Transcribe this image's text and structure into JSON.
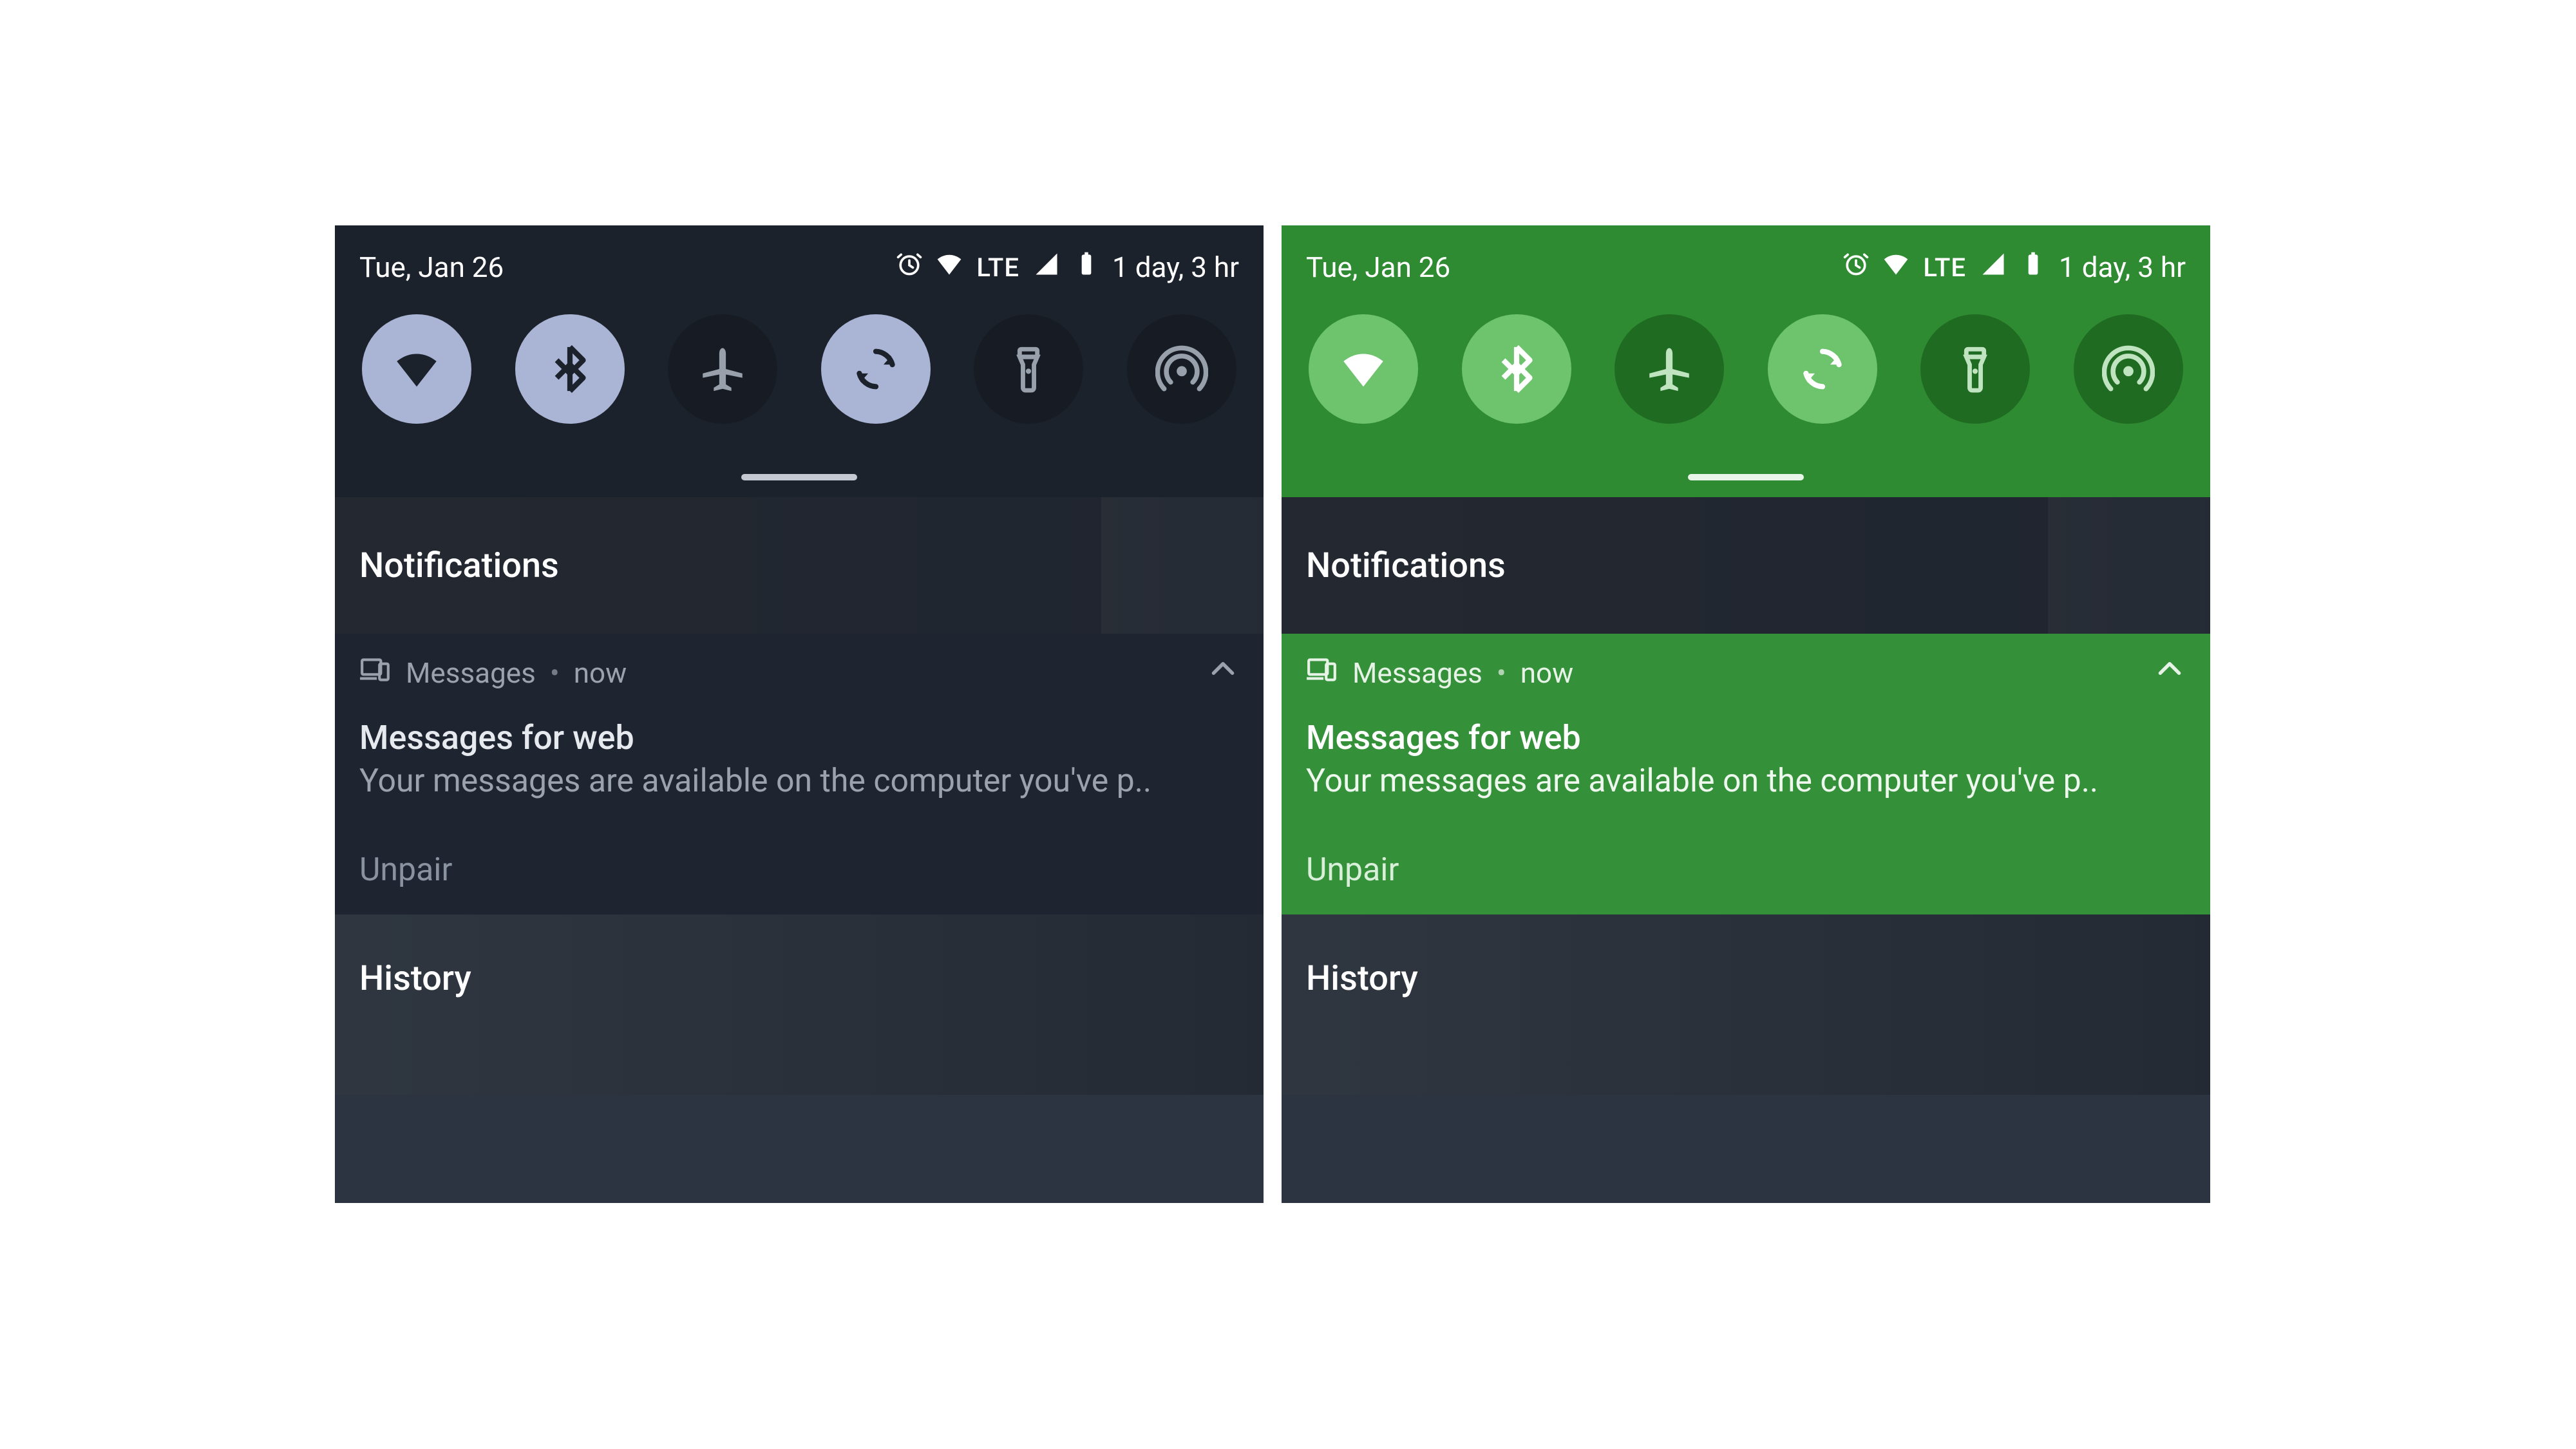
{
  "status": {
    "date": "Tue, Jan 26",
    "network_label": "LTE",
    "battery_text": "1 day, 3 hr"
  },
  "tiles": [
    {
      "name": "wifi",
      "active": true
    },
    {
      "name": "bluetooth",
      "active": true
    },
    {
      "name": "airplane",
      "active": false
    },
    {
      "name": "auto-rotate",
      "active": true
    },
    {
      "name": "flashlight",
      "active": false
    },
    {
      "name": "hotspot",
      "active": false
    }
  ],
  "sections": {
    "notifications": "Notifications",
    "history": "History"
  },
  "notification": {
    "app": "Messages",
    "time": "now",
    "title": "Messages for web",
    "body": "Your messages are available on the computer you've p..",
    "action": "Unpair"
  },
  "themes": {
    "dark": {
      "qs_bg": "#1c222c",
      "tile_on": "#aab5d6",
      "tile_off": "#171c24"
    },
    "green": {
      "qs_bg": "#2e8b31",
      "tile_on": "#6dc46d",
      "tile_off": "#1f6b22"
    }
  }
}
